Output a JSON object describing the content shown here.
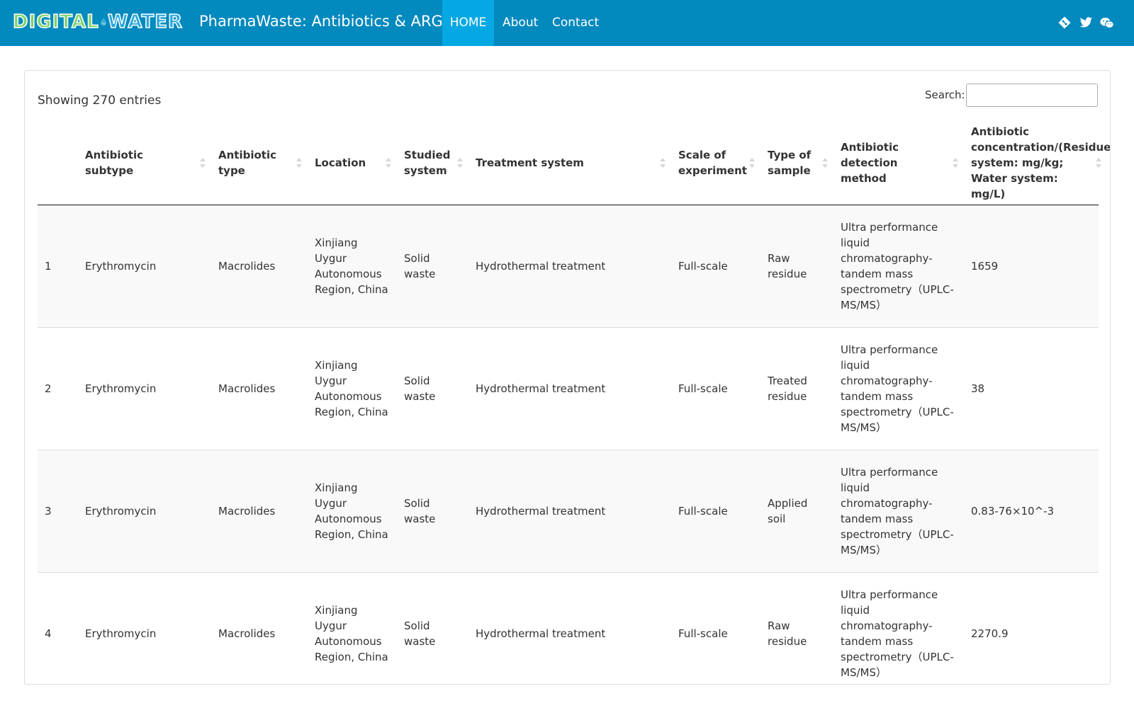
{
  "navbar": {
    "logo_part1": "DIGITAL",
    "logo_part2": "WATER",
    "title": "PharmaWaste: Antibiotics & ARGs",
    "links": {
      "home": "HOME",
      "about": "About",
      "contact": "Contact"
    },
    "icons": [
      "git-icon",
      "twitter-icon",
      "wechat-icon"
    ],
    "colors": {
      "bar": "#0289be",
      "active": "#05a8e3"
    }
  },
  "table_info": "Showing 270 entries",
  "search": {
    "label": "Search:",
    "value": ""
  },
  "columns": [
    "",
    "Antibiotic subtype",
    "Antibiotic type",
    "Location",
    "Studied system",
    "Treatment system",
    "Scale of experiment",
    "Type of sample",
    "Antibiotic detection method",
    "Antibiotic concentration/(Residue system: mg/kg; Water system: mg/L)"
  ],
  "rows": [
    [
      "1",
      "Erythromycin",
      "Macrolides",
      "Xinjiang Uygur Autonomous Region, China",
      "Solid waste",
      "Hydrothermal treatment",
      "Full-scale",
      "Raw residue",
      "Ultra performance liquid chromatography-tandem mass spectrometry（UPLC-MS/MS）",
      "1659"
    ],
    [
      "2",
      "Erythromycin",
      "Macrolides",
      "Xinjiang Uygur Autonomous Region, China",
      "Solid waste",
      "Hydrothermal treatment",
      "Full-scale",
      "Treated residue",
      "Ultra performance liquid chromatography-tandem mass spectrometry（UPLC-MS/MS）",
      "38"
    ],
    [
      "3",
      "Erythromycin",
      "Macrolides",
      "Xinjiang Uygur Autonomous Region, China",
      "Solid waste",
      "Hydrothermal treatment",
      "Full-scale",
      "Applied soil",
      "Ultra performance liquid chromatography-tandem mass spectrometry（UPLC-MS/MS）",
      "0.83-76×10^-3"
    ],
    [
      "4",
      "Erythromycin",
      "Macrolides",
      "Xinjiang Uygur Autonomous Region, China",
      "Solid waste",
      "Hydrothermal treatment",
      "Full-scale",
      "Raw residue",
      "Ultra performance liquid chromatography-tandem mass spectrometry（UPLC-MS/MS）",
      "2270.9"
    ]
  ]
}
